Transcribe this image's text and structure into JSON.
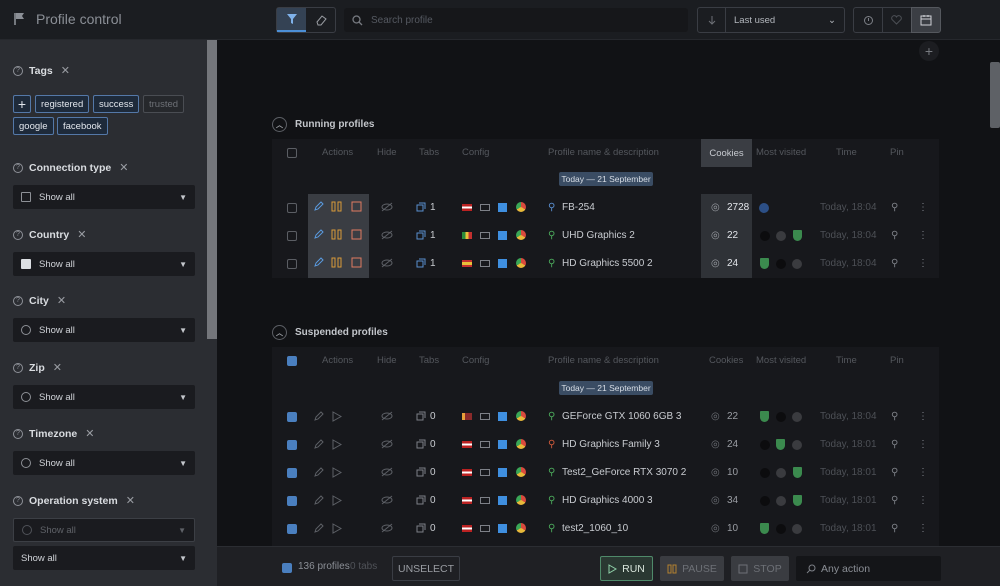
{
  "app": {
    "title": "Profile control"
  },
  "search": {
    "placeholder": "Search profile"
  },
  "sort": {
    "value": "Last used"
  },
  "sidebar": {
    "tags": {
      "title": "Tags",
      "items": [
        "registered",
        "success",
        "trusted",
        "google",
        "facebook"
      ]
    },
    "filters": [
      {
        "title": "Connection type",
        "value": "Show all"
      },
      {
        "title": "Country",
        "value": "Show all"
      },
      {
        "title": "City",
        "value": "Show all"
      },
      {
        "title": "Zip",
        "value": "Show all"
      },
      {
        "title": "Timezone",
        "value": "Show all"
      },
      {
        "title": "Operation system",
        "value": "Show all",
        "value2": "Show all"
      }
    ]
  },
  "columns": [
    "Actions",
    "Hide",
    "Tabs",
    "Config",
    "Profile name & description",
    "Cookies",
    "Most visited",
    "Time",
    "Pin"
  ],
  "running": {
    "title": "Running profiles",
    "date": "Today — 21 September",
    "rows": [
      {
        "tabs": "1",
        "name": "FB-254",
        "cookies": "2728",
        "time": "Today, 18:04",
        "flag": "us"
      },
      {
        "tabs": "1",
        "name": "UHD Graphics 2",
        "cookies": "22",
        "time": "Today, 18:04",
        "flag": "it"
      },
      {
        "tabs": "1",
        "name": "HD Graphics 5500 2",
        "cookies": "24",
        "time": "Today, 18:04",
        "flag": "es"
      }
    ]
  },
  "suspended": {
    "title": "Suspended profiles",
    "date": "Today — 21 September",
    "rows": [
      {
        "tabs": "0",
        "name": "GEForce GTX 1060 6GB 3",
        "cookies": "22",
        "time": "Today, 18:04",
        "flag": "lk"
      },
      {
        "tabs": "0",
        "name": "HD Graphics Family 3",
        "cookies": "24",
        "time": "Today, 18:01",
        "flag": "us"
      },
      {
        "tabs": "0",
        "name": "Test2_GeForce RTX 3070 2",
        "cookies": "10",
        "time": "Today, 18:01",
        "flag": "us"
      },
      {
        "tabs": "0",
        "name": "HD Graphics 4000 3",
        "cookies": "34",
        "time": "Today, 18:01",
        "flag": "us"
      },
      {
        "tabs": "0",
        "name": "test2_1060_10",
        "cookies": "10",
        "time": "Today, 18:01",
        "flag": "us"
      }
    ]
  },
  "footer": {
    "count": "136 profiles",
    "tabs": "0 tabs",
    "unselect": "UNSELECT",
    "run": "RUN",
    "pause": "PAUSE",
    "stop": "STOP",
    "action": "Any action"
  },
  "colors": {
    "accent": "#4c8fd6",
    "run_border": "#4f8a6a",
    "pause": "#d99a3a",
    "edit": "#4c8fd6"
  }
}
